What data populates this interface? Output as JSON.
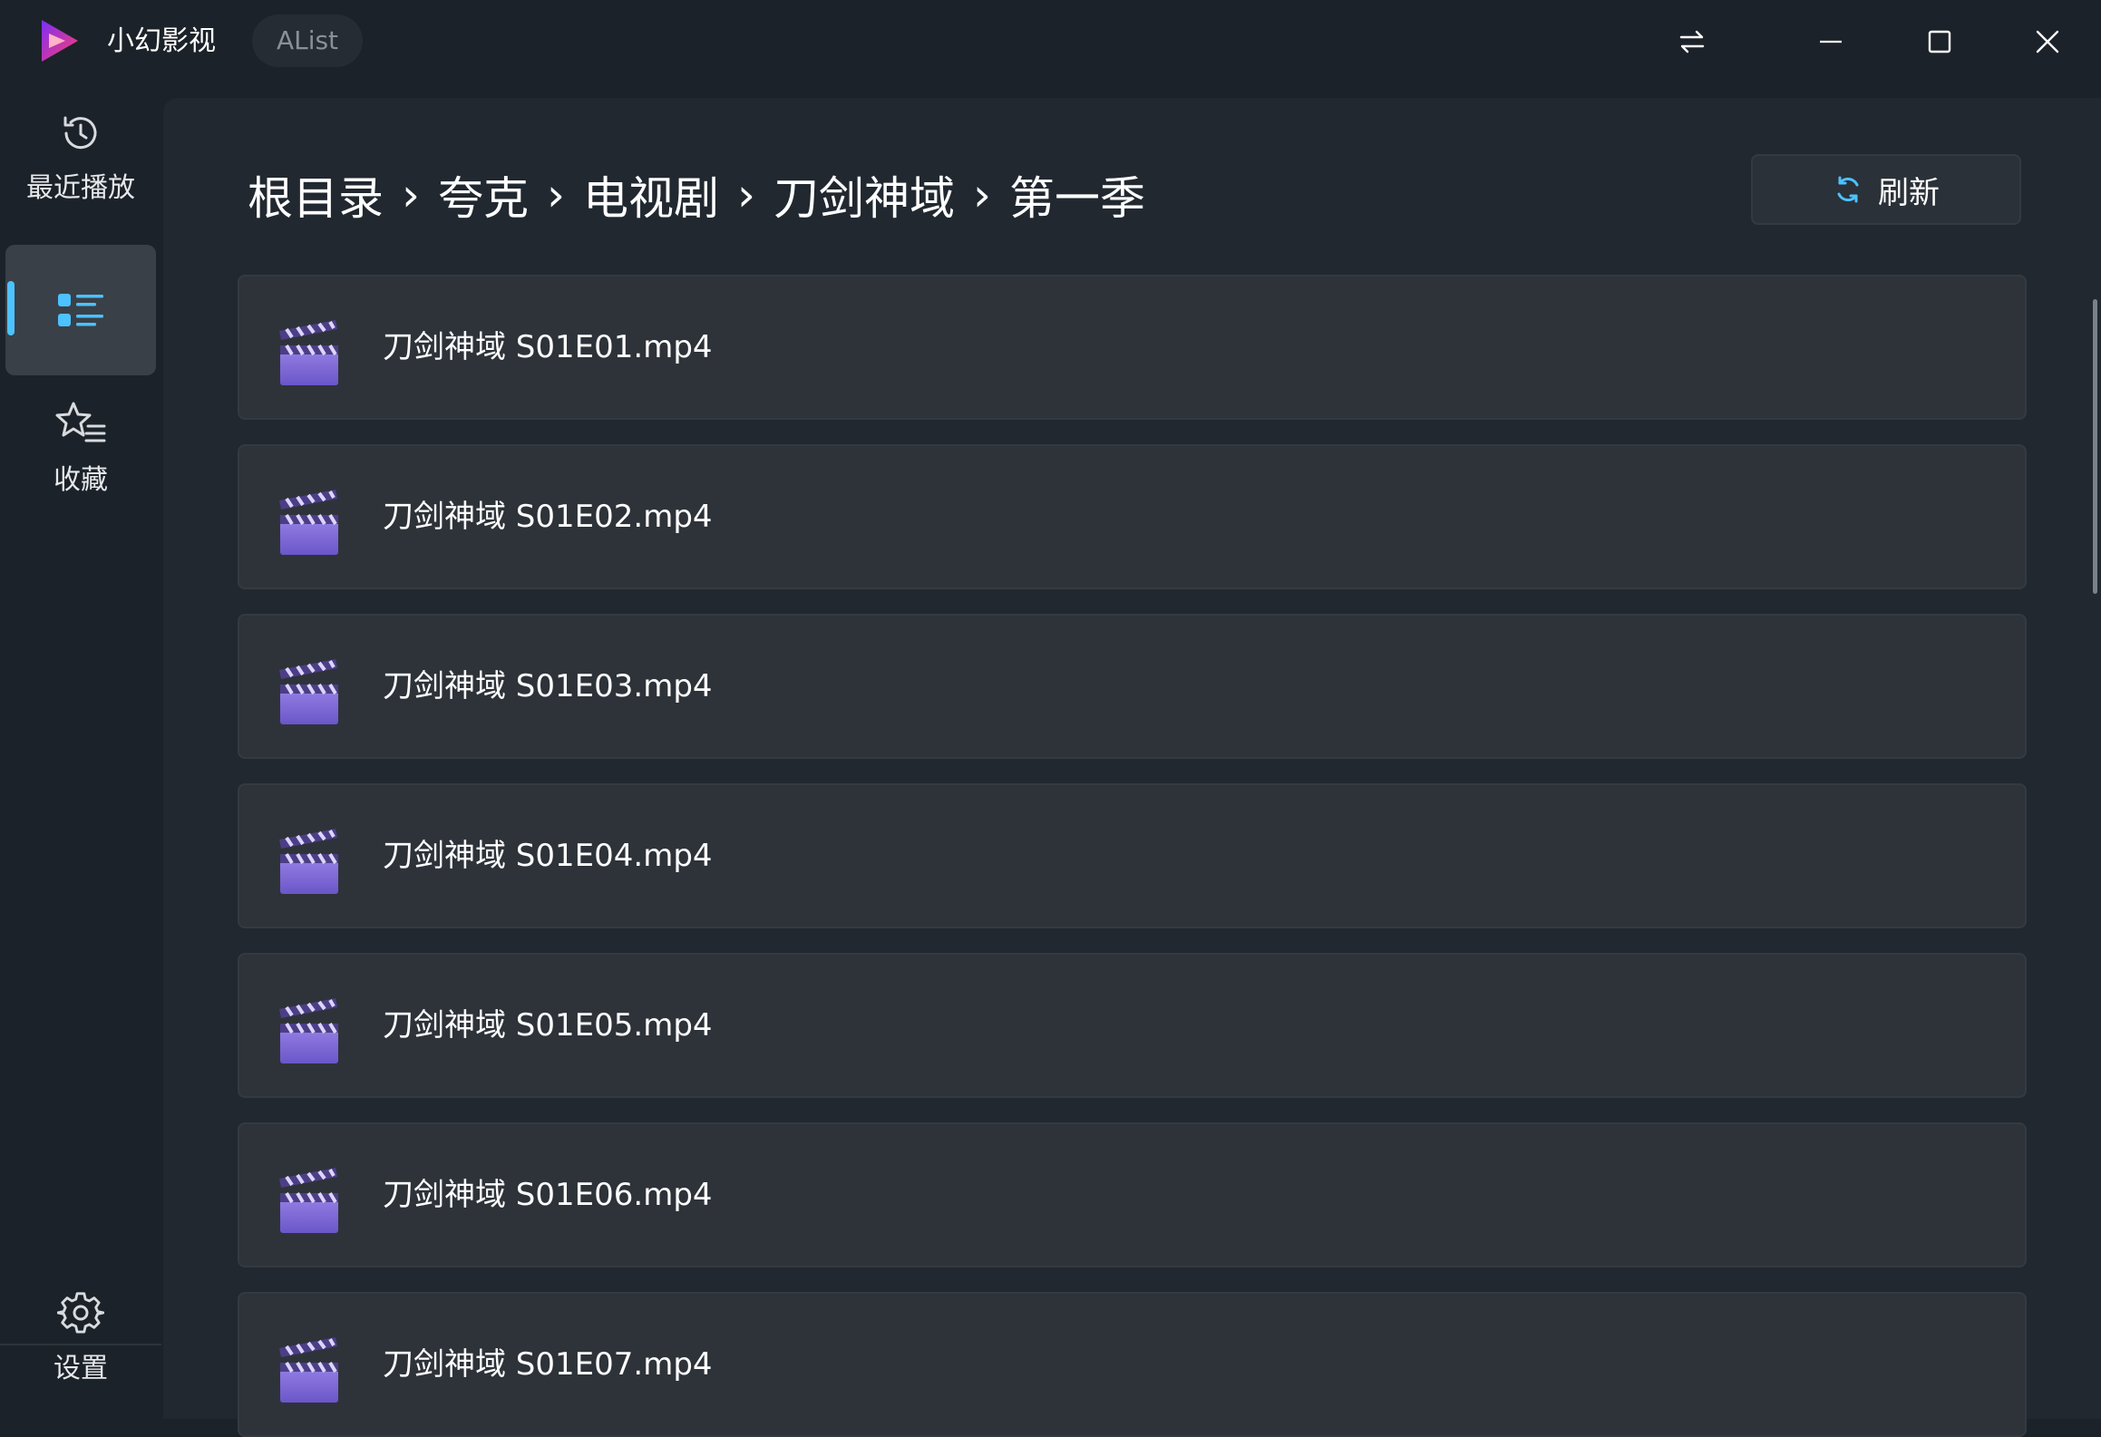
{
  "window": {
    "app_title": "小幻影视",
    "source_tag": "AList",
    "buttons": {
      "swap": "swap-icon",
      "minimize": "minimize-icon",
      "maximize": "maximize-icon",
      "close": "close-icon"
    }
  },
  "sidebar": {
    "items": [
      {
        "label": "最近播放",
        "icon": "history-icon",
        "active": false
      },
      {
        "label": "",
        "icon": "list-icon",
        "active": true
      },
      {
        "label": "收藏",
        "icon": "star-list-icon",
        "active": false
      }
    ],
    "settings": {
      "label": "设置",
      "icon": "gear-icon"
    }
  },
  "breadcrumb": [
    "根目录",
    "夸克",
    "电视剧",
    "刀剑神域",
    "第一季"
  ],
  "refresh_label": "刷新",
  "files": [
    {
      "name": "刀剑神域 S01E01.mp4",
      "icon": "clapperboard-icon"
    },
    {
      "name": "刀剑神域 S01E02.mp4",
      "icon": "clapperboard-icon"
    },
    {
      "name": "刀剑神域 S01E03.mp4",
      "icon": "clapperboard-icon"
    },
    {
      "name": "刀剑神域 S01E04.mp4",
      "icon": "clapperboard-icon"
    },
    {
      "name": "刀剑神域 S01E05.mp4",
      "icon": "clapperboard-icon"
    },
    {
      "name": "刀剑神域 S01E06.mp4",
      "icon": "clapperboard-icon"
    },
    {
      "name": "刀剑神域 S01E07.mp4",
      "icon": "clapperboard-icon"
    }
  ],
  "colors": {
    "accent": "#4cc2ff",
    "background": "#1c2229",
    "content_bg": "#212830",
    "row_bg": "#2e333a"
  }
}
